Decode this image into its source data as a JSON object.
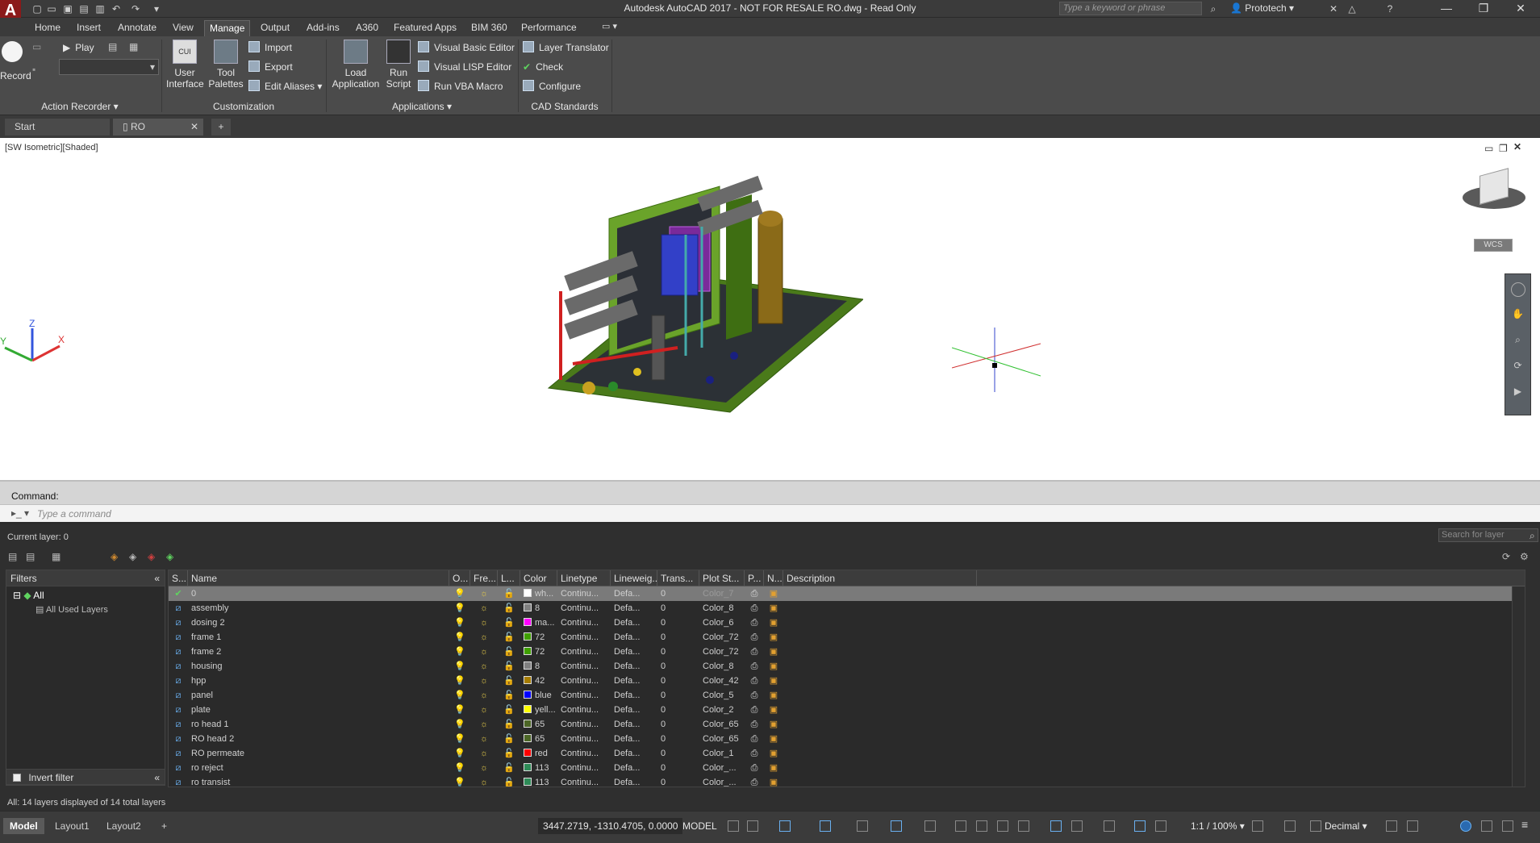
{
  "titlebar": {
    "title": "Autodesk AutoCAD 2017 - NOT FOR RESALE    RO.dwg - Read Only",
    "logo": "A",
    "search_placeholder": "Type a keyword or phrase",
    "user": "Prototech"
  },
  "ribbon_tabs": [
    "Home",
    "Insert",
    "Annotate",
    "View",
    "Manage",
    "Output",
    "Add-ins",
    "A360",
    "Featured Apps",
    "BIM 360",
    "Performance"
  ],
  "ribbon": {
    "action_recorder": {
      "record": "Record",
      "play": "Play",
      "title": "Action Recorder"
    },
    "customization": {
      "user_interface": [
        "User",
        "Interface"
      ],
      "tool_palettes": [
        "Tool",
        "Palettes"
      ],
      "import": "Import",
      "export": "Export",
      "edit_aliases": "Edit Aliases",
      "title": "Customization"
    },
    "applications": {
      "load_application": [
        "Load",
        "Application"
      ],
      "run_script": [
        "Run",
        "Script"
      ],
      "vb_editor": "Visual Basic Editor",
      "lisp_editor": "Visual LISP Editor",
      "run_vba": "Run VBA Macro",
      "title": "Applications"
    },
    "cad_standards": {
      "layer_translator": "Layer Translator",
      "check": "Check",
      "configure": "Configure",
      "title": "CAD Standards"
    }
  },
  "file_tabs": [
    "Start",
    "RO"
  ],
  "viewport": {
    "label": "[SW Isometric][Shaded]",
    "wcs": "WCS",
    "ucs_axes": [
      "X",
      "Y",
      "Z"
    ]
  },
  "command": {
    "history_label": "Command:",
    "placeholder": "Type a command"
  },
  "layers": {
    "current": "Current layer: 0",
    "search_placeholder": "Search for layer",
    "filters_title": "Filters",
    "filter_all": "All",
    "filter_used": "All Used Layers",
    "invert_filter": "Invert filter",
    "status": "All: 14 layers displayed of 14 total layers",
    "columns": [
      "S...",
      "Name",
      "O...",
      "Fre...",
      "L...",
      "Color",
      "Linetype",
      "Lineweig...",
      "Trans...",
      "Plot St...",
      "P...",
      "N...",
      "Description"
    ],
    "rows": [
      {
        "name": "0",
        "color_name": "wh...",
        "color_hex": "#ffffff",
        "linetype": "Continu...",
        "lineweight": "Defa...",
        "trans": "0",
        "plot_style": "Color_7"
      },
      {
        "name": "assembly",
        "color_name": "8",
        "color_hex": "#808080",
        "linetype": "Continu...",
        "lineweight": "Defa...",
        "trans": "0",
        "plot_style": "Color_8"
      },
      {
        "name": "dosing 2",
        "color_name": "ma...",
        "color_hex": "#ff00ff",
        "linetype": "Continu...",
        "lineweight": "Defa...",
        "trans": "0",
        "plot_style": "Color_6"
      },
      {
        "name": "frame 1",
        "color_name": "72",
        "color_hex": "#3f9f00",
        "linetype": "Continu...",
        "lineweight": "Defa...",
        "trans": "0",
        "plot_style": "Color_72"
      },
      {
        "name": "frame 2",
        "color_name": "72",
        "color_hex": "#3f9f00",
        "linetype": "Continu...",
        "lineweight": "Defa...",
        "trans": "0",
        "plot_style": "Color_72"
      },
      {
        "name": "housing",
        "color_name": "8",
        "color_hex": "#808080",
        "linetype": "Continu...",
        "lineweight": "Defa...",
        "trans": "0",
        "plot_style": "Color_8"
      },
      {
        "name": "hpp",
        "color_name": "42",
        "color_hex": "#a67c00",
        "linetype": "Continu...",
        "lineweight": "Defa...",
        "trans": "0",
        "plot_style": "Color_42"
      },
      {
        "name": "panel",
        "color_name": "blue",
        "color_hex": "#0000ff",
        "linetype": "Continu...",
        "lineweight": "Defa...",
        "trans": "0",
        "plot_style": "Color_5"
      },
      {
        "name": "plate",
        "color_name": "yell...",
        "color_hex": "#ffff00",
        "linetype": "Continu...",
        "lineweight": "Defa...",
        "trans": "0",
        "plot_style": "Color_2"
      },
      {
        "name": "ro head 1",
        "color_name": "65",
        "color_hex": "#4c6626",
        "linetype": "Continu...",
        "lineweight": "Defa...",
        "trans": "0",
        "plot_style": "Color_65"
      },
      {
        "name": "RO head 2",
        "color_name": "65",
        "color_hex": "#4c6626",
        "linetype": "Continu...",
        "lineweight": "Defa...",
        "trans": "0",
        "plot_style": "Color_65"
      },
      {
        "name": "RO permeate",
        "color_name": "red",
        "color_hex": "#ff0000",
        "linetype": "Continu...",
        "lineweight": "Defa...",
        "trans": "0",
        "plot_style": "Color_1"
      },
      {
        "name": "ro reject",
        "color_name": "113",
        "color_hex": "#2e8b57",
        "linetype": "Continu...",
        "lineweight": "Defa...",
        "trans": "0",
        "plot_style": "Color_..."
      },
      {
        "name": "ro transist",
        "color_name": "113",
        "color_hex": "#2e8b57",
        "linetype": "Continu...",
        "lineweight": "Defa...",
        "trans": "0",
        "plot_style": "Color_..."
      }
    ]
  },
  "statusbar": {
    "layout_tabs": [
      "Model",
      "Layout1",
      "Layout2"
    ],
    "coordinates": "3447.2719, -1310.4705, 0.0000",
    "model": "MODEL",
    "scale": "1:1 / 100%",
    "units": "Decimal"
  }
}
